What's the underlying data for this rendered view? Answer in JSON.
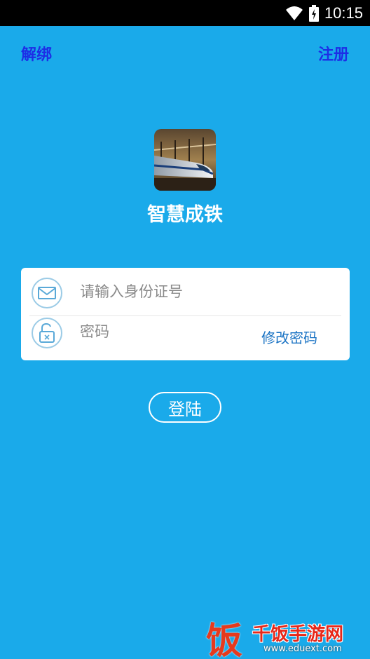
{
  "status_bar": {
    "time": "10:15"
  },
  "top": {
    "unbind_label": "解绑",
    "register_label": "注册"
  },
  "app": {
    "name": "智慧成铁"
  },
  "form": {
    "id_placeholder": "请输入身份证号",
    "id_value": "",
    "password_placeholder": "密码",
    "password_value": "",
    "change_password_label": "修改密码"
  },
  "login_button": {
    "label": "登陆"
  },
  "watermark": {
    "logo_char": "饭",
    "text": "千饭手游网",
    "url": "www.eduext.com"
  },
  "colors": {
    "background": "#1aaaea",
    "top_link": "#1d2ee6",
    "change_password": "#1a73c4"
  },
  "icons": [
    "wifi-icon",
    "battery-icon",
    "mail-icon",
    "unlock-icon"
  ]
}
